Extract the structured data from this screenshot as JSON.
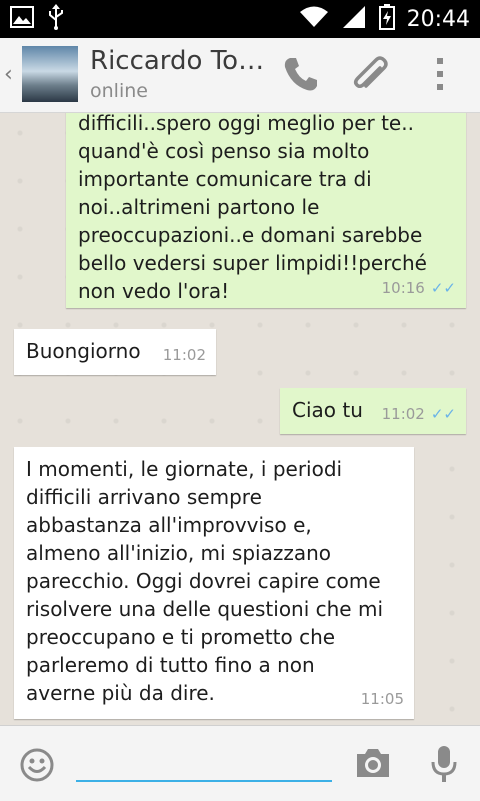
{
  "status_bar": {
    "time": "20:44",
    "icons": [
      "image-icon",
      "usb-icon",
      "wifi-icon",
      "signal-icon",
      "battery-charging-icon"
    ]
  },
  "app_bar": {
    "back_glyph": "‹",
    "contact_name": "Riccardo To…",
    "contact_status": "online",
    "icons": [
      "phone-icon",
      "attach-icon",
      "overflow-menu-icon"
    ]
  },
  "messages": [
    {
      "direction": "out",
      "text": "difficili..spero oggi meglio per te..\nquand'è così penso sia molto\nimportante comunicare tra di\nnoi..altrimeni partono le\npreoccupazioni..e domani sarebbe\nbello vedersi super limpidi!!perché\nnon vedo l'ora!",
      "time": "10:16",
      "ticks": "✓✓"
    },
    {
      "direction": "in",
      "text": "Buongiorno",
      "time": "11:02"
    },
    {
      "direction": "out",
      "text": "Ciao tu",
      "time": "11:02",
      "ticks": "✓✓"
    },
    {
      "direction": "in",
      "text": "I momenti, le giornate, i periodi\ndifficili arrivano sempre\nabbastanza all'improvviso e,\nalmeno all'inizio, mi spiazzano\nparecchio. Oggi dovrei capire come\nrisolvere una delle questioni che mi\npreoccupano e ti prometto che\nparleremo di tutto fino a non\naverne più da dire.",
      "time": "11:05"
    }
  ],
  "input_bar": {
    "icons": [
      "emoji-icon",
      "camera-icon",
      "microphone-icon"
    ],
    "message_value": ""
  },
  "colors": {
    "outgoing_bubble": "#e1f7cb",
    "incoming_bubble": "#ffffff",
    "read_ticks": "#6ab3e8",
    "input_underline": "#3cb0e6"
  }
}
